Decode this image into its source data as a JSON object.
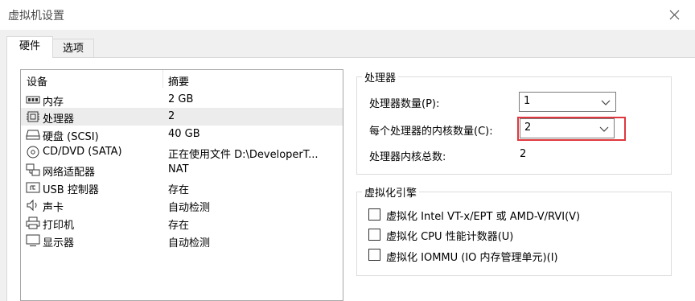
{
  "window": {
    "title": "虚拟机设置"
  },
  "tabs": [
    {
      "label": "硬件"
    },
    {
      "label": "选项"
    }
  ],
  "device_list": {
    "columns": [
      "设备",
      "摘要"
    ],
    "rows": [
      {
        "icon": "memory-icon",
        "name": "内存",
        "summary": "2 GB"
      },
      {
        "icon": "processor-icon",
        "name": "处理器",
        "summary": "2"
      },
      {
        "icon": "hard-disk-icon",
        "name": "硬盘 (SCSI)",
        "summary": "40 GB"
      },
      {
        "icon": "cd-dvd-icon",
        "name": "CD/DVD (SATA)",
        "summary": "正在使用文件 D:\\DeveloperT..."
      },
      {
        "icon": "network-adapter-icon",
        "name": "网络适配器",
        "summary": "NAT"
      },
      {
        "icon": "usb-icon",
        "name": "USB 控制器",
        "summary": "存在"
      },
      {
        "icon": "sound-card-icon",
        "name": "声卡",
        "summary": "自动检测"
      },
      {
        "icon": "printer-icon",
        "name": "打印机",
        "summary": "存在"
      },
      {
        "icon": "display-icon",
        "name": "显示器",
        "summary": "自动检测"
      }
    ],
    "selected_index": 1
  },
  "processor_group": {
    "title": "处理器",
    "count_label": "处理器数量(P):",
    "count_value": "1",
    "cores_label": "每个处理器的内核数量(C):",
    "cores_value": "2",
    "total_label": "处理器内核总数:",
    "total_value": "2"
  },
  "virt_group": {
    "title": "虚拟化引擎",
    "options": [
      {
        "label": "虚拟化 Intel VT-x/EPT 或 AMD-V/RVI(V)",
        "checked": false
      },
      {
        "label": "虚拟化 CPU 性能计数器(U)",
        "checked": false
      },
      {
        "label": "虚拟化 IOMMU (IO 内存管理单元)(I)",
        "checked": false
      }
    ]
  },
  "colors": {
    "highlight": "#e0383e",
    "selected_row": "#ececec"
  }
}
